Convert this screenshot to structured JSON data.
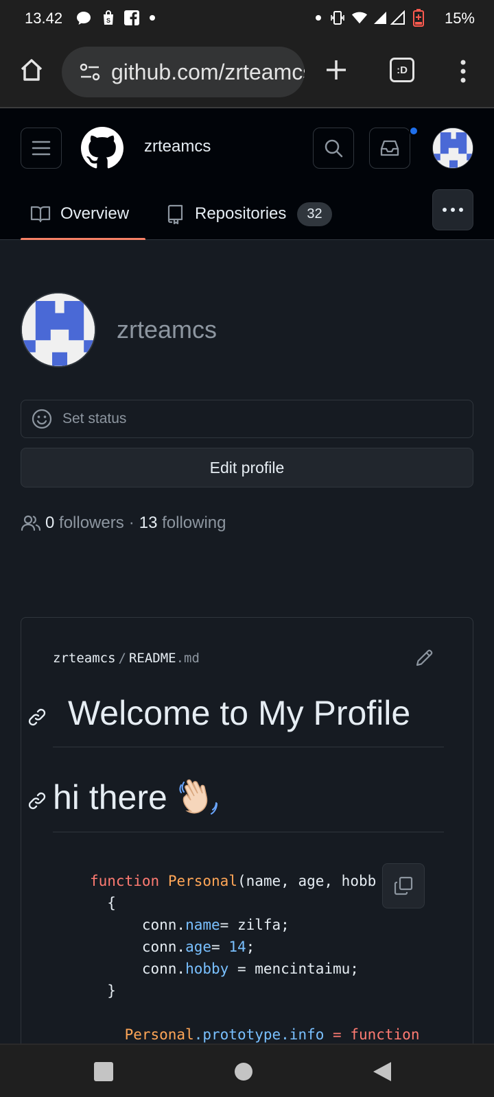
{
  "status_bar": {
    "time": "13.42",
    "battery": "15%",
    "left_icons": [
      "message-icon",
      "shop-icon",
      "facebook-icon",
      "dot-icon"
    ],
    "right_icons": [
      "dot-icon",
      "vibrate-icon",
      "wifi-icon",
      "signal-icon",
      "signal-icon",
      "battery-icon"
    ]
  },
  "browser": {
    "url": "github.com/zrteamcs",
    "tab_switcher_label": ":D"
  },
  "header": {
    "username": "zrteamcs",
    "tabs": [
      {
        "label": "Overview",
        "icon": "book-icon",
        "active": true
      },
      {
        "label": "Repositories",
        "icon": "repo-icon",
        "count": "32"
      }
    ]
  },
  "profile": {
    "name": "zrteamcs",
    "status_placeholder": "Set status",
    "edit_button": "Edit profile",
    "followers_count": "0",
    "followers_label": "followers",
    "separator": "·",
    "following_count": "13",
    "following_label": "following"
  },
  "readme": {
    "owner": "zrteamcs",
    "slash": "/",
    "file_base": "README",
    "file_ext": ".md",
    "heading1": "Welcome to My Profile",
    "heading2": "hi there",
    "code": {
      "line1_kw": "function",
      "line1_fn": "Personal",
      "line1_rest": "(name, age, hobb",
      "line2": "  {",
      "line3_obj": "      conn.",
      "line3_prop": "name",
      "line3_rest": "= zilfa;",
      "line4_obj": "      conn.",
      "line4_prop": "age",
      "line4_rest": "= ",
      "line4_num": "14",
      "line4_end": ";",
      "line5_obj": "      conn.",
      "line5_prop": "hobby",
      "line5_rest": " = mencintaimu;",
      "line6": "  }",
      "line7_fn": "Personal",
      "line7_prop": ".prototype.info",
      "line7_rest": " = ",
      "line7_kw": "function"
    }
  },
  "colors": {
    "accent_underline": "#f78166",
    "notification": "#1f6feb",
    "avatar_blue": "#4a69d6"
  }
}
